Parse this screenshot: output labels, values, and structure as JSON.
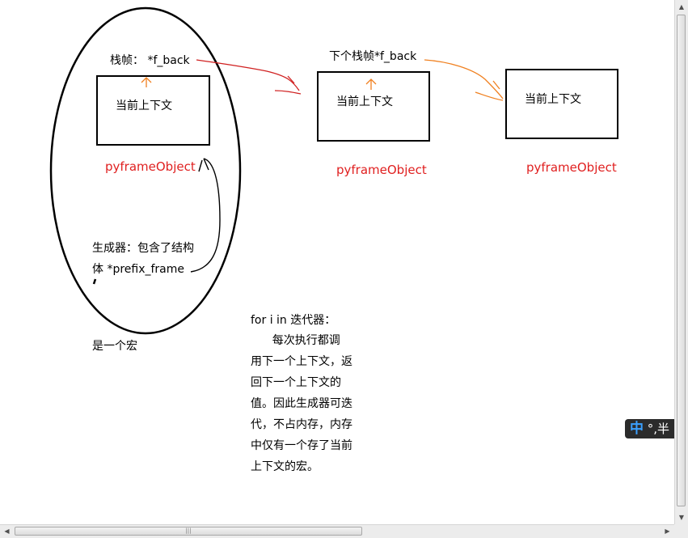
{
  "frames": {
    "first_label": "栈帧： *f_back",
    "second_label": "下个栈帧*f_back",
    "box_text": "当前上下文",
    "object_label": "pyframeObject"
  },
  "generator": {
    "line1": "生成器：包含了结构",
    "line2": "体 *prefix_frame",
    "macro": "是一个宏"
  },
  "explanation": {
    "heading": "for i in 迭代器：",
    "lines": [
      "      每次执行都调",
      "用下一个上下文，返",
      "回下一个上下文的",
      "值。因此生成器可迭",
      "代，不占内存，内存",
      "中仅有一个存了当前",
      "上下文的宏。"
    ]
  },
  "ime": {
    "mode": "中",
    "punct": "°,半"
  },
  "colors": {
    "red_arrow": "#d02020",
    "orange_arrow": "#f08020",
    "label_red": "#e02020"
  }
}
